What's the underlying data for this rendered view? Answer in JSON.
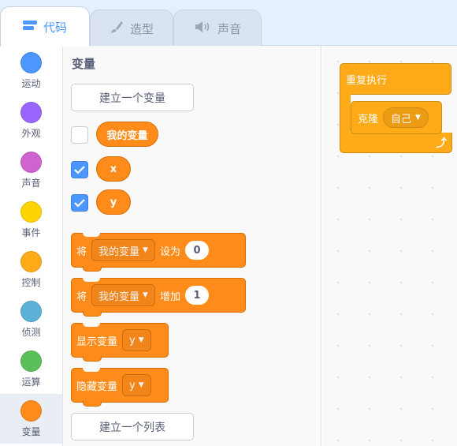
{
  "tabs": [
    {
      "label": "代码",
      "icon": "code-icon",
      "active": true
    },
    {
      "label": "造型",
      "icon": "brush-icon",
      "active": false
    },
    {
      "label": "声音",
      "icon": "speaker-icon",
      "active": false
    }
  ],
  "categories": [
    {
      "label": "运动",
      "color": "#4c97ff"
    },
    {
      "label": "外观",
      "color": "#9966ff"
    },
    {
      "label": "声音",
      "color": "#cf63cf"
    },
    {
      "label": "事件",
      "color": "#ffd500"
    },
    {
      "label": "控制",
      "color": "#ffab19"
    },
    {
      "label": "侦测",
      "color": "#5cb1d6"
    },
    {
      "label": "运算",
      "color": "#59c059"
    },
    {
      "label": "变量",
      "color": "#ff8c1a"
    }
  ],
  "palette": {
    "title": "变量",
    "make_variable": "建立一个变量",
    "make_list": "建立一个列表",
    "variables": [
      {
        "name": "我的变量",
        "checked": false
      },
      {
        "name": "x",
        "checked": true
      },
      {
        "name": "y",
        "checked": true
      }
    ],
    "set_block": {
      "prefix": "将",
      "variable": "我的变量",
      "middle": "设为",
      "value": "0"
    },
    "change_block": {
      "prefix": "将",
      "variable": "我的变量",
      "middle": "增加",
      "value": "1"
    },
    "show_block": {
      "label": "显示变量",
      "variable": "y"
    },
    "hide_block": {
      "label": "隐藏变量",
      "variable": "y"
    }
  },
  "script": {
    "loop_label": "重复执行",
    "clone_label": "克隆",
    "clone_target": "自己"
  }
}
